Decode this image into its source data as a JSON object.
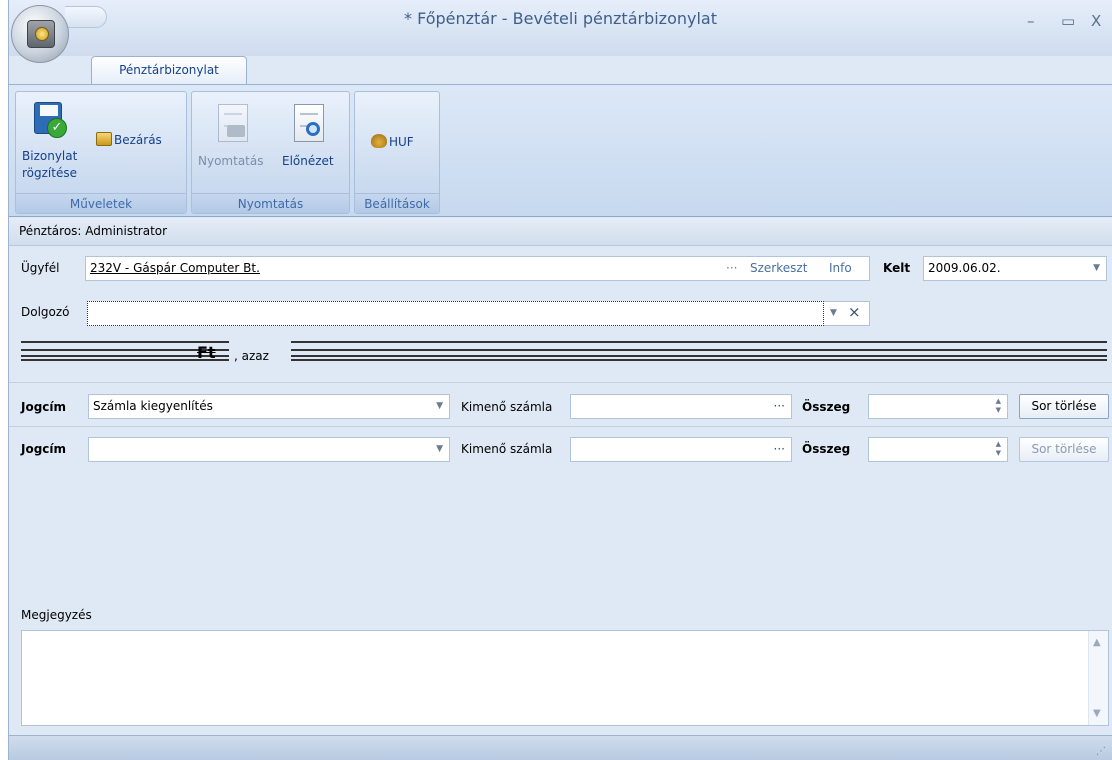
{
  "window": {
    "title": "* Főpénztár - Bevételi pénztárbizonylat",
    "minimize": "–",
    "maximize": "▭",
    "close": "X"
  },
  "ribbon": {
    "tab_label": "Pénztárbizonylat",
    "groups": {
      "muveletek": {
        "label": "Műveletek",
        "save_line1": "Bizonylat",
        "save_line2": "rögzítése",
        "close_label": "Bezárás"
      },
      "nyomtatas": {
        "label": "Nyomtatás",
        "print_label": "Nyomtatás",
        "preview_label": "Előnézet"
      },
      "beallitasok": {
        "label": "Beállítások",
        "currency_label": "HUF"
      }
    }
  },
  "cashier": {
    "text": "Pénztáros: Administrator"
  },
  "form": {
    "customer": {
      "label": "Ügyfél",
      "value": "232V - Gáspár Computer Bt.",
      "dots": "···",
      "edit_label": "Szerkeszt",
      "info_label": "Info"
    },
    "date": {
      "label": "Kelt",
      "value": "2009.06.02."
    },
    "employee": {
      "label": "Dolgozó",
      "value": ""
    },
    "amount_words": {
      "currency": "Ft",
      "azaz": ", azaz"
    },
    "rows": [
      {
        "title_label": "Jogcím",
        "title_value": "Számla kiegyenlítés",
        "invoice_label": "Kimenő számla",
        "invoice_value": "",
        "sum_label": "Összeg",
        "sum_value": "",
        "delete_label": "Sor törlése",
        "delete_enabled": true
      },
      {
        "title_label": "Jogcím",
        "title_value": "",
        "invoice_label": "Kimenő számla",
        "invoice_value": "",
        "sum_label": "Összeg",
        "sum_value": "",
        "delete_label": "Sor törlése",
        "delete_enabled": false
      }
    ],
    "notes": {
      "label": "Megjegyzés",
      "value": ""
    }
  },
  "icons": {
    "app": "safe-icon",
    "save": "save-check-icon",
    "close": "folder-close-icon",
    "print": "print-doc-icon",
    "preview": "preview-doc-icon",
    "currency": "money-bag-icon"
  },
  "colors": {
    "accent": "#15428b",
    "ribbon_bg": "#c7d9ef",
    "window_bg": "#dfe9f5"
  }
}
